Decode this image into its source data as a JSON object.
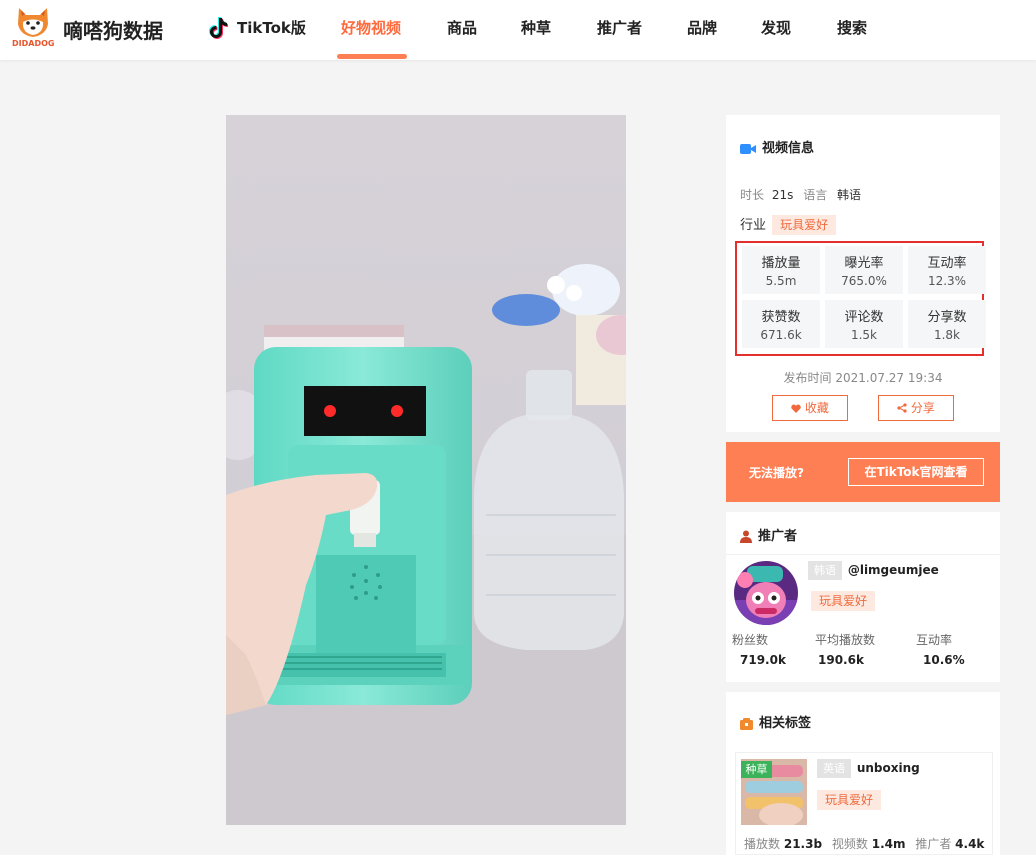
{
  "header": {
    "logo_text": "DIDADOG",
    "site_name": "嘀嗒狗数据",
    "nav": [
      "TikTok版",
      "好物视频",
      "商品",
      "种草",
      "推广者",
      "品牌",
      "发现",
      "搜索"
    ],
    "active_nav": "好物视频",
    "accent_color": "#ff6a3d"
  },
  "video_info": {
    "title": "视频信息",
    "duration_label": "时长",
    "duration": "21s",
    "language_label": "语言",
    "language": "韩语",
    "industry_label": "行业",
    "industry": "玩具爱好",
    "stats": [
      {
        "label": "播放量",
        "value": "5.5m"
      },
      {
        "label": "曝光率",
        "value": "765.0%"
      },
      {
        "label": "互动率",
        "value": "12.3%"
      },
      {
        "label": "获赞数",
        "value": "671.6k"
      },
      {
        "label": "评论数",
        "value": "1.5k"
      },
      {
        "label": "分享数",
        "value": "1.8k"
      }
    ],
    "publish_label": "发布时间",
    "publish_time": "2021.07.27 19:34",
    "favorite_label": "收藏",
    "share_label": "分享"
  },
  "playback": {
    "cannot_play": "无法播放?",
    "view_on_tiktok": "在TikTok官网查看"
  },
  "promoter": {
    "title": "推广者",
    "language_tag": "韩语",
    "handle": "@limgeumjee",
    "category": "玩具爱好",
    "metrics": [
      {
        "label": "粉丝数",
        "value": "719.0k"
      },
      {
        "label": "平均播放数",
        "value": "190.6k"
      },
      {
        "label": "互动率",
        "value": "10.6%"
      }
    ]
  },
  "related_tags": {
    "title": "相关标签",
    "badge": "种草",
    "language_tag": "英语",
    "name": "unboxing",
    "category": "玩具爱好",
    "plays_label": "播放数",
    "plays": "21.3b",
    "videos_label": "视频数",
    "videos": "1.4m",
    "promoters_label": "推广者",
    "promoters": "4.4k"
  }
}
